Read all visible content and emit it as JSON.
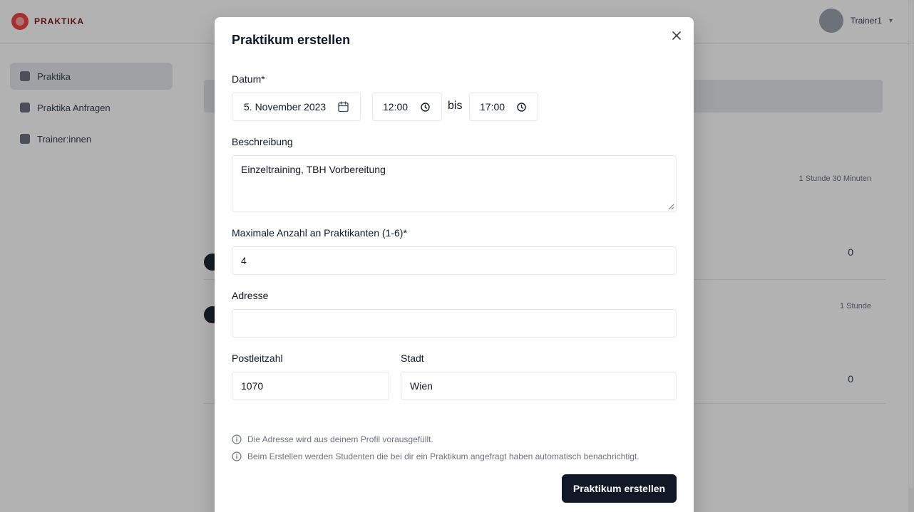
{
  "app": {
    "logo_text": "PRAKTIKA",
    "user_name": "Trainer1",
    "sidebar": {
      "items": [
        {
          "label": "Praktika",
          "active": true
        },
        {
          "label": "Praktika Anfragen",
          "active": false
        },
        {
          "label": "Trainer:innen",
          "active": false
        }
      ]
    },
    "background_texts": {
      "duration_1": "1 Stunde 30 Minuten",
      "duration_2": "1 Stunde",
      "count_1": "0",
      "count_2": "0"
    }
  },
  "modal": {
    "title": "Praktikum erstellen",
    "date_label": "Datum*",
    "date_value": "5. November 2023",
    "time_start": "12:00",
    "time_separator": "bis",
    "time_end": "17:00",
    "description_label": "Beschreibung",
    "description_value": "Einzeltraining, TBH Vorbereitung",
    "max_label": "Maximale Anzahl an Praktikanten (1-6)*",
    "max_value": "4",
    "address_label": "Adresse",
    "address_value": "",
    "zip_label": "Postleitzahl",
    "zip_value": "1070",
    "city_label": "Stadt",
    "city_value": "Wien",
    "info": [
      "Die Adresse wird aus deinem Profil vorausgefüllt.",
      "Beim Erstellen werden Studenten die bei dir ein Praktikum angefragt haben automatisch benachrichtigt."
    ],
    "submit_label": "Praktikum erstellen"
  }
}
